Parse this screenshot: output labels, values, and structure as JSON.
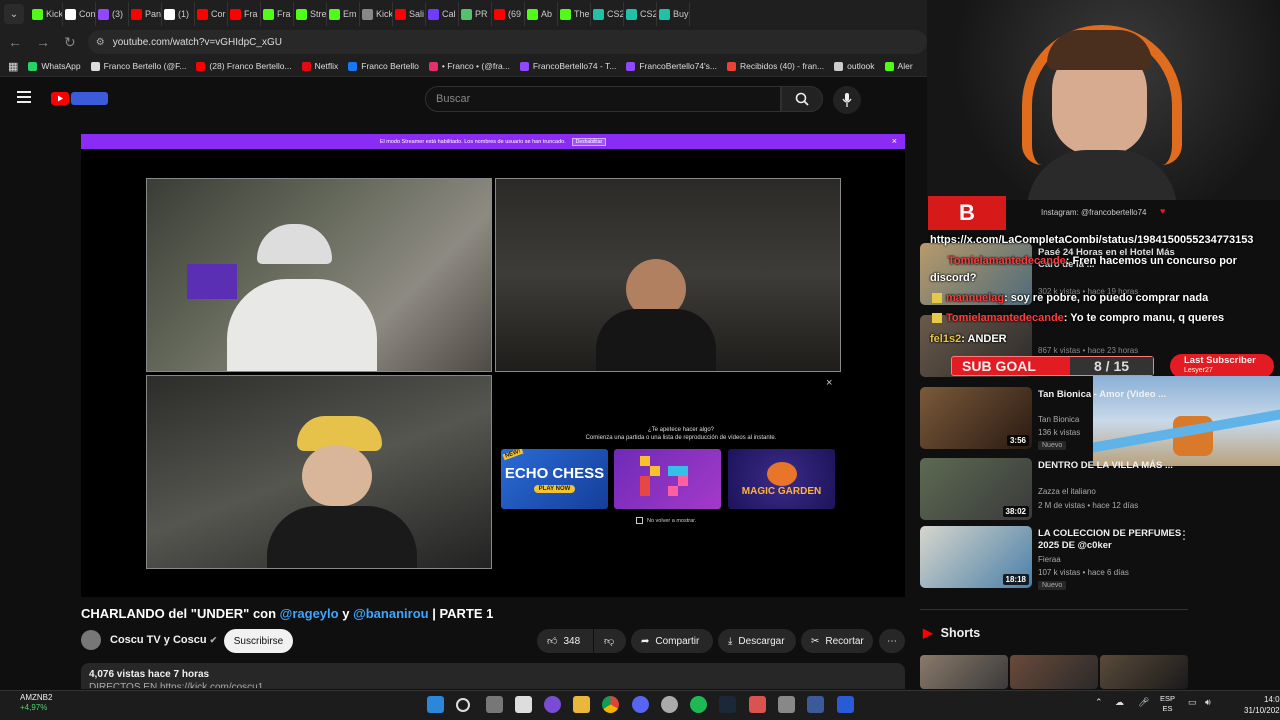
{
  "browser": {
    "tabs": [
      {
        "label": "Kick",
        "color": "#53fc18"
      },
      {
        "label": "Con",
        "color": "#ffffff"
      },
      {
        "label": "(3)",
        "color": "#9146ff"
      },
      {
        "label": "Pan",
        "color": "#ff0000"
      },
      {
        "label": "(1)",
        "color": "#ffffff"
      },
      {
        "label": "Cor",
        "color": "#ff0000"
      },
      {
        "label": "Fra",
        "color": "#ff0000"
      },
      {
        "label": "Fra",
        "color": "#53fc18"
      },
      {
        "label": "Stre",
        "color": "#53fc18"
      },
      {
        "label": "Em",
        "color": "#53fc18"
      },
      {
        "label": "Kick",
        "color": "#888888"
      },
      {
        "label": "Sali",
        "color": "#ff0000"
      },
      {
        "label": "Cal",
        "color": "#6e3bff"
      },
      {
        "label": "PR",
        "color": "#53c26b"
      },
      {
        "label": "(69",
        "color": "#ff0000"
      },
      {
        "label": "Ab",
        "color": "#53fc18"
      },
      {
        "label": "The",
        "color": "#53fc18"
      },
      {
        "label": "CS2",
        "color": "#22c0a8"
      },
      {
        "label": "CS2",
        "color": "#22c0a8"
      },
      {
        "label": "Buy",
        "color": "#22c0a8"
      }
    ],
    "url": "youtube.com/watch?v=vGHIdpC_xGU",
    "bookmarks": [
      {
        "label": "WhatsApp",
        "color": "#25d366"
      },
      {
        "label": "Franco Bertello (@F...",
        "color": "#dddddd"
      },
      {
        "label": "(28) Franco Bertello...",
        "color": "#ff0000"
      },
      {
        "label": "Netflix",
        "color": "#e50914"
      },
      {
        "label": "Franco Bertello",
        "color": "#1877f2"
      },
      {
        "label": "• Franco • (@fra...",
        "color": "#e1306c"
      },
      {
        "label": "FrancoBertello74 - T...",
        "color": "#9146ff"
      },
      {
        "label": "FrancoBertello74's...",
        "color": "#9146ff"
      },
      {
        "label": "Recibidos (40) - fran...",
        "color": "#ea4335"
      },
      {
        "label": "outlook",
        "color": "#cccccc"
      },
      {
        "label": "Aler",
        "color": "#53fc18"
      }
    ]
  },
  "youtube": {
    "search_placeholder": "Buscar",
    "banner_text": "El modo Streamer está habilitado. Los nombres de usuario se han truncado.",
    "banner_button": "Deshabilitar",
    "popup_line1": "¿Te apetece hacer algo?",
    "popup_line2": "Comienza una partida o una lista de reproducción de vídeos al instante.",
    "games": [
      {
        "label": "ECHO CHESS",
        "badge": "NEW!",
        "cta": "PLAY NOW"
      },
      {
        "label": ""
      },
      {
        "label": "MAGIC GARDEN"
      }
    ],
    "no_show": "No volver a mostrar.",
    "title_parts": {
      "a": "CHARLANDO del \"UNDER\" con ",
      "b": "@rageylo",
      "c": " y ",
      "d": "@bananirou",
      "e": " | PARTE 1"
    },
    "channel": "Coscu TV y Coscu",
    "subscribe": "Suscribirse",
    "likes": "348",
    "share": "Compartir",
    "download": "Descargar",
    "clip": "Recortar",
    "views_line": "4,076 vistas  hace 7 horas",
    "desc_line": "DIRECTOS EN https://kick.com/coscu1..."
  },
  "overlay": {
    "chat_lines": [
      {
        "user": "",
        "msg": "https://x.com/LaCompletaCombi/status/1984150055234773153"
      },
      {
        "user": "Tomielamantedecande",
        "msg": ": Fren hacemos un concurso por"
      },
      {
        "user": "",
        "msg": "discord?"
      },
      {
        "user": "mannuelag",
        "msg": ": soy re pobre, no puedo comprar nada"
      },
      {
        "user": "Tomielamantedecande",
        "msg": ": Yo te compro manu, q queres"
      },
      {
        "user": "fel1s2",
        "msg": ": ANDER"
      }
    ],
    "social": "Instagram: @francobertello74",
    "sub_goal_label": "SUB GOAL",
    "sub_goal_value": "8 / 15",
    "last_sub_label": "Last Subscriber",
    "last_sub_name": "Lesyer27"
  },
  "recommended": [
    {
      "title": "Pasé 24 Horas en el Hotel Más Caro de la ...",
      "channel": "Nil OGT",
      "stats": "302 k vistas • hace 19 horas",
      "duration": "",
      "nuevo": "Nuevo"
    },
    {
      "title": "\"Mi amigo ... Full Judz For Oh Dio",
      "channel": "",
      "stats": "867 k vistas • hace 23 horas",
      "duration": "",
      "nuevo": ""
    },
    {
      "title": "Tan Bionica - Amor (Video ...",
      "channel": "Tan Bionica",
      "stats": "136 k vistas",
      "duration": "3:56",
      "nuevo": "Nuevo"
    },
    {
      "title": "DENTRO DE LA VILLA MÁS ...",
      "channel": "Zazza el italiano",
      "stats": "2 M de vistas • hace 12 días",
      "duration": "38:02",
      "nuevo": ""
    },
    {
      "title": "LA COLECCION DE PERFUMES 2025 DE @c0ker",
      "channel": "Fieraa",
      "stats": "107 k vistas • hace 6 días",
      "duration": "18:18",
      "nuevo": "Nuevo"
    }
  ],
  "shorts_label": "Shorts",
  "taskbar": {
    "stock_name": "AMZNB2",
    "stock_change": "+4,97%",
    "lang1": "ESP",
    "lang2": "ES",
    "time": "14:03",
    "date": "31/10/2025"
  }
}
